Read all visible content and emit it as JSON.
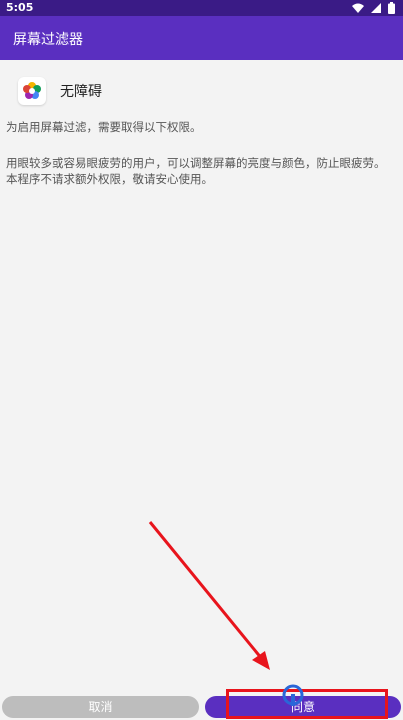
{
  "status_bar": {
    "time": "5:05",
    "icons": [
      "wifi-icon",
      "signal-icon",
      "battery-icon"
    ]
  },
  "app_bar": {
    "title": "屏幕过滤器"
  },
  "app_info": {
    "name": "无障碍",
    "icon": "flower-app-icon"
  },
  "description": {
    "line1": "为启用屏幕过滤，需要取得以下权限。",
    "line2": "用眼较多或容易眼疲劳的用户，可以调整屏幕的亮度与颜色，防止眼疲劳。",
    "line3": "本程序不请求额外权限，敬请安心使用。"
  },
  "buttons": {
    "cancel": "取消",
    "agree": "同意"
  },
  "colors": {
    "status_bar": "#3a1b86",
    "app_bar": "#5a2fc0",
    "agree_button": "#5a2fc0",
    "cancel_button": "#bdbdbd",
    "annotation": "#e8141c"
  },
  "overlay": {
    "watermark_icon": "watermark-logo-icon"
  }
}
